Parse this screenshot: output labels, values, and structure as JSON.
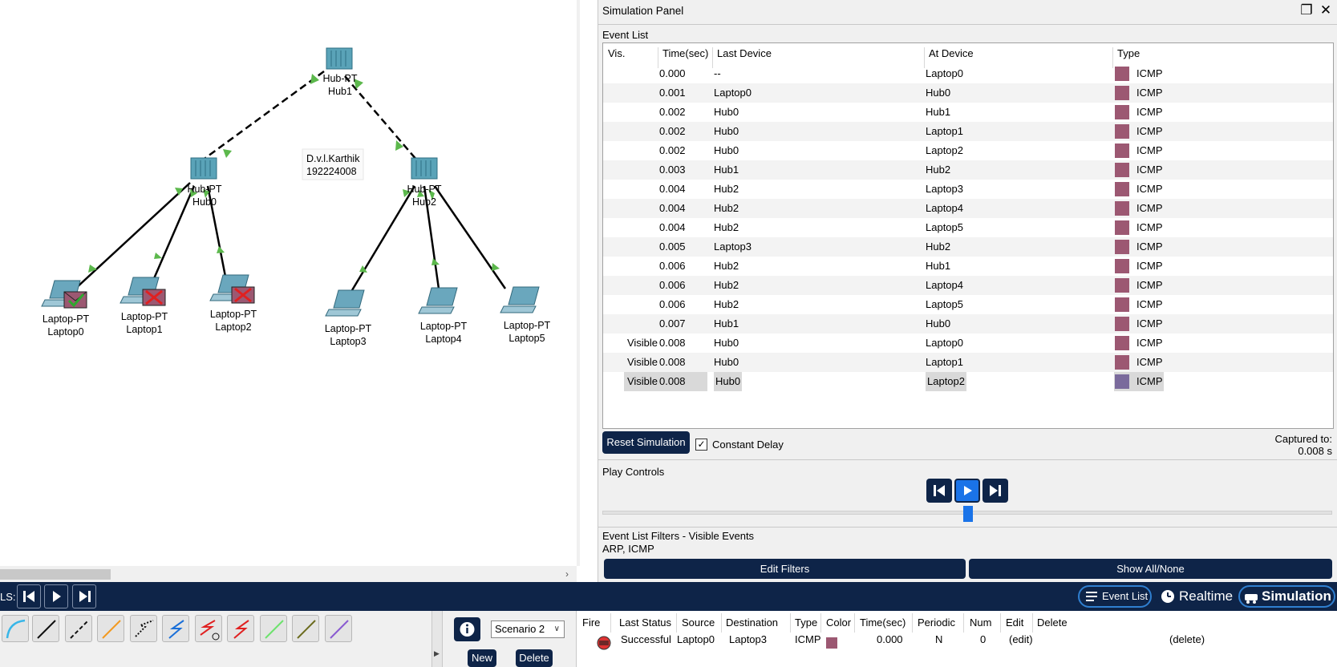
{
  "topology": {
    "devices": [
      {
        "id": "hub1",
        "type_label": "Hub-PT",
        "name": "Hub1"
      },
      {
        "id": "hub0",
        "type_label": "Hub-PT",
        "name": "Hub0"
      },
      {
        "id": "hub2",
        "type_label": "Hub-PT",
        "name": "Hub2"
      },
      {
        "id": "laptop0",
        "type_label": "Laptop-PT",
        "name": "Laptop0"
      },
      {
        "id": "laptop1",
        "type_label": "Laptop-PT",
        "name": "Laptop1"
      },
      {
        "id": "laptop2",
        "type_label": "Laptop-PT",
        "name": "Laptop2"
      },
      {
        "id": "laptop3",
        "type_label": "Laptop-PT",
        "name": "Laptop3"
      },
      {
        "id": "laptop4",
        "type_label": "Laptop-PT",
        "name": "Laptop4"
      },
      {
        "id": "laptop5",
        "type_label": "Laptop-PT",
        "name": "Laptop5"
      }
    ],
    "note": {
      "line1": "D.v.l.Karthik",
      "line2": "192224008"
    }
  },
  "sim_panel": {
    "title": "Simulation Panel",
    "event_list_label": "Event List",
    "columns": {
      "vis": "Vis.",
      "time": "Time(sec)",
      "last": "Last Device",
      "at": "At Device",
      "type": "Type"
    },
    "events": [
      {
        "vis": "",
        "time": "0.000",
        "last": "--",
        "at": "Laptop0",
        "type": "ICMP"
      },
      {
        "vis": "",
        "time": "0.001",
        "last": "Laptop0",
        "at": "Hub0",
        "type": "ICMP"
      },
      {
        "vis": "",
        "time": "0.002",
        "last": "Hub0",
        "at": "Hub1",
        "type": "ICMP"
      },
      {
        "vis": "",
        "time": "0.002",
        "last": "Hub0",
        "at": "Laptop1",
        "type": "ICMP"
      },
      {
        "vis": "",
        "time": "0.002",
        "last": "Hub0",
        "at": "Laptop2",
        "type": "ICMP"
      },
      {
        "vis": "",
        "time": "0.003",
        "last": "Hub1",
        "at": "Hub2",
        "type": "ICMP"
      },
      {
        "vis": "",
        "time": "0.004",
        "last": "Hub2",
        "at": "Laptop3",
        "type": "ICMP"
      },
      {
        "vis": "",
        "time": "0.004",
        "last": "Hub2",
        "at": "Laptop4",
        "type": "ICMP"
      },
      {
        "vis": "",
        "time": "0.004",
        "last": "Hub2",
        "at": "Laptop5",
        "type": "ICMP"
      },
      {
        "vis": "",
        "time": "0.005",
        "last": "Laptop3",
        "at": "Hub2",
        "type": "ICMP"
      },
      {
        "vis": "",
        "time": "0.006",
        "last": "Hub2",
        "at": "Hub1",
        "type": "ICMP"
      },
      {
        "vis": "",
        "time": "0.006",
        "last": "Hub2",
        "at": "Laptop4",
        "type": "ICMP"
      },
      {
        "vis": "",
        "time": "0.006",
        "last": "Hub2",
        "at": "Laptop5",
        "type": "ICMP"
      },
      {
        "vis": "",
        "time": "0.007",
        "last": "Hub1",
        "at": "Hub0",
        "type": "ICMP"
      },
      {
        "vis": "Visible",
        "time": "0.008",
        "last": "Hub0",
        "at": "Laptop0",
        "type": "ICMP"
      },
      {
        "vis": "Visible",
        "time": "0.008",
        "last": "Hub0",
        "at": "Laptop1",
        "type": "ICMP"
      },
      {
        "vis": "Visible",
        "time": "0.008",
        "last": "Hub0",
        "at": "Laptop2",
        "type": "ICMP"
      }
    ],
    "reset_label": "Reset Simulation",
    "constant_delay_label": "Constant Delay",
    "captured_label": "Captured to:",
    "captured_value": "0.008 s",
    "play_controls_label": "Play Controls",
    "filters_label": "Event List Filters - Visible Events",
    "filters_value": "ARP, ICMP",
    "edit_filters_label": "Edit Filters",
    "show_all_label": "Show All/None",
    "colors": {
      "icmp": "#9c5872",
      "icmp_selected": "#7a6a9c",
      "accent": "#0e2448",
      "play_active": "#1a73e8"
    }
  },
  "bottombar": {
    "realtime_short": "LS:",
    "event_list_label": "Event List",
    "realtime_label": "Realtime",
    "simulation_label": "Simulation"
  },
  "scenario": {
    "selected": "Scenario 2",
    "new_label": "New",
    "delete_label": "Delete"
  },
  "pdu": {
    "columns": {
      "fire": "Fire",
      "status": "Last Status",
      "source": "Source",
      "dest": "Destination",
      "type": "Type",
      "color": "Color",
      "time": "Time(sec)",
      "periodic": "Periodic",
      "num": "Num",
      "edit": "Edit",
      "delete": "Delete"
    },
    "row": {
      "status": "Successful",
      "source": "Laptop0",
      "dest": "Laptop3",
      "type": "ICMP",
      "time": "0.000",
      "periodic": "N",
      "num": "0",
      "edit": "(edit)",
      "delete": "(delete)"
    }
  }
}
